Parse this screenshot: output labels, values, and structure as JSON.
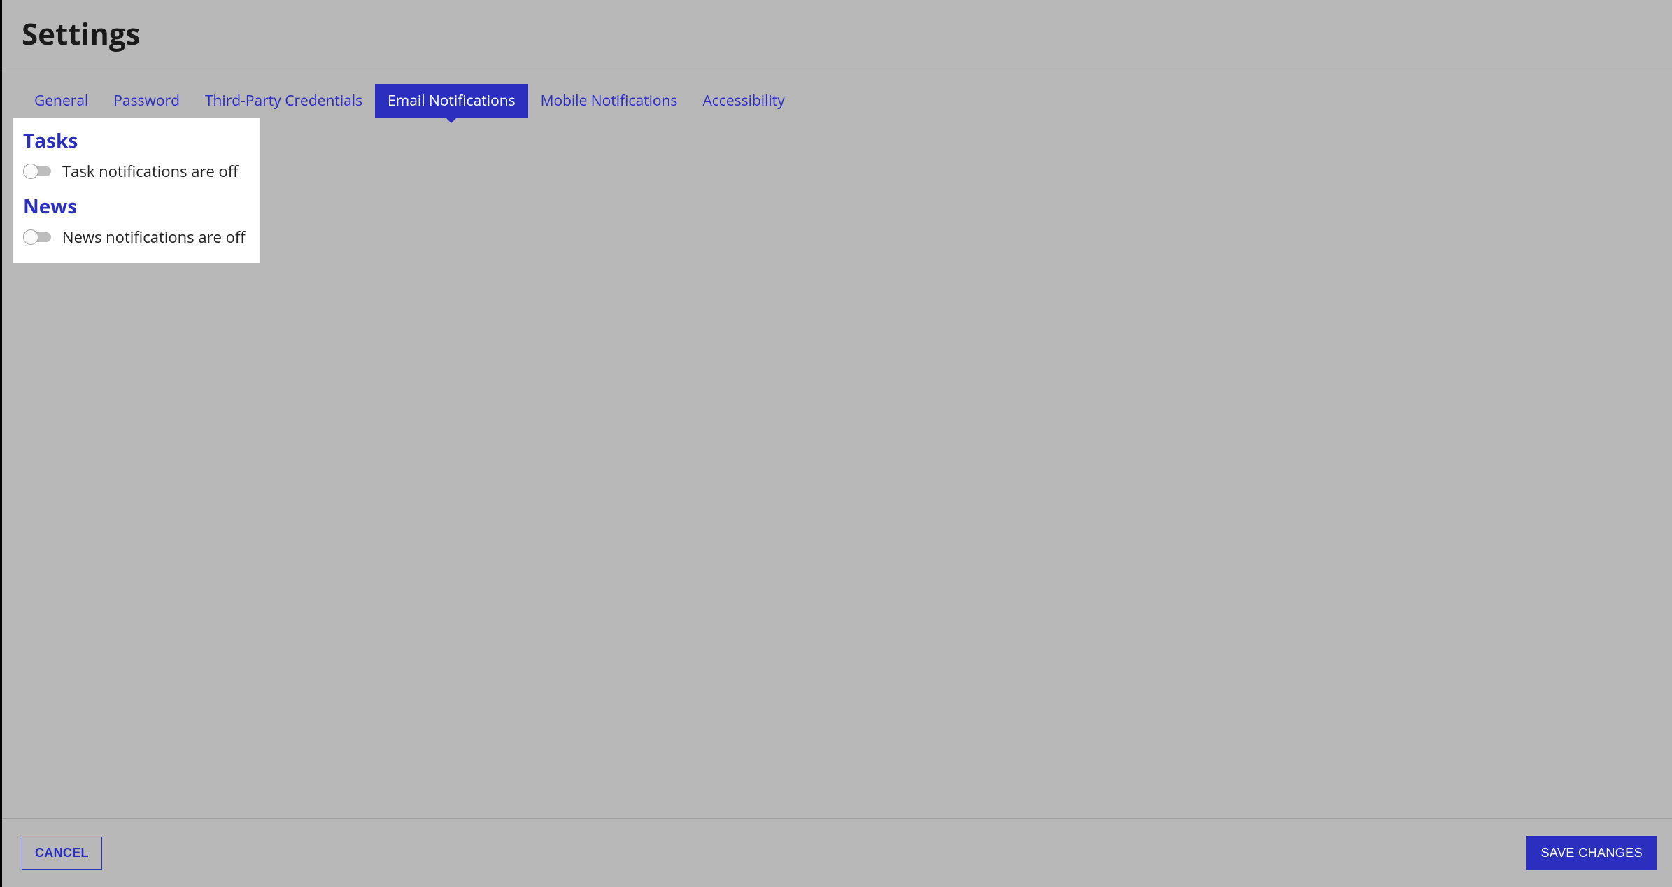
{
  "header": {
    "title": "Settings"
  },
  "tabs": [
    {
      "label": "General",
      "active": false
    },
    {
      "label": "Password",
      "active": false
    },
    {
      "label": "Third-Party Credentials",
      "active": false
    },
    {
      "label": "Email Notifications",
      "active": true
    },
    {
      "label": "Mobile Notifications",
      "active": false
    },
    {
      "label": "Accessibility",
      "active": false
    }
  ],
  "panel": {
    "sections": [
      {
        "heading": "Tasks",
        "toggle_state": "off",
        "status_text": "Task notifications are off"
      },
      {
        "heading": "News",
        "toggle_state": "off",
        "status_text": "News notifications are off"
      }
    ]
  },
  "footer": {
    "cancel_label": "CANCEL",
    "save_label": "SAVE CHANGES"
  },
  "colors": {
    "accent": "#2a2fbf",
    "background": "#b8b8b8",
    "panel_bg": "#ffffff"
  }
}
